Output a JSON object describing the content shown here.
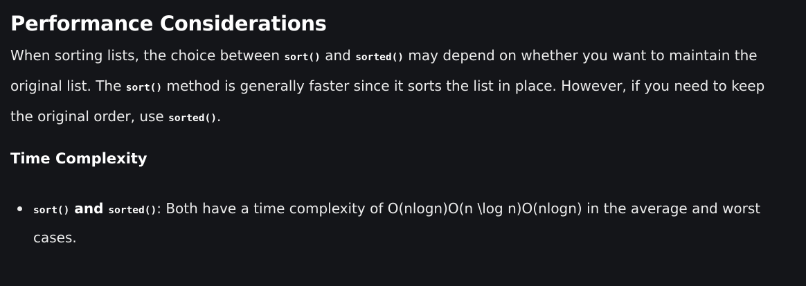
{
  "section": {
    "heading": "Performance Considerations",
    "intro": {
      "t1": "When sorting lists, the choice between ",
      "c1": "sort()",
      "t2": " and ",
      "c2": "sorted()",
      "t3": " may depend on whether you want to maintain the original list. The ",
      "c3": "sort()",
      "t4": " method is generally faster since it sorts the list in place. However, if you need to keep the original order, use ",
      "c4": "sorted()",
      "t5": "."
    }
  },
  "subsection": {
    "heading": "Time Complexity",
    "items": [
      {
        "code1": "sort()",
        "bold_and": " and ",
        "code2": "sorted()",
        "text": ": Both have a time complexity of O(nlogn)O(n \\log n)O(nlogn) in the average and worst cases."
      }
    ]
  }
}
